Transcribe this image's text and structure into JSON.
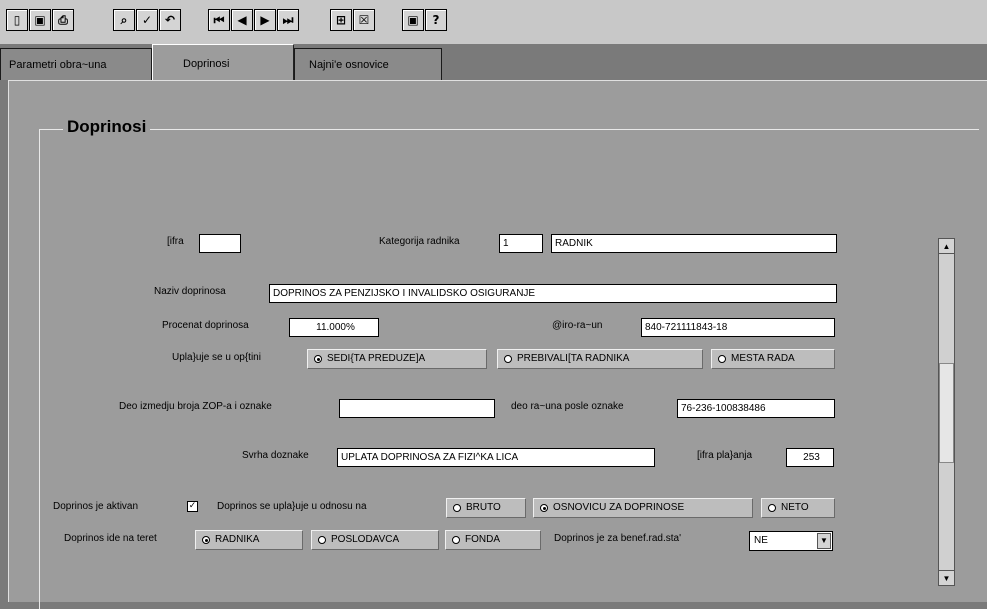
{
  "toolbar": {
    "groups": [
      [
        "exit-icon",
        "save-icon",
        "print-icon"
      ],
      [
        "search-icon",
        "confirm-icon",
        "undo-icon"
      ],
      [
        "first-record-icon",
        "previous-record-icon",
        "next-record-icon",
        "last-record-icon"
      ],
      [
        "add-record-icon",
        "delete-record-icon"
      ],
      [
        "info-icon",
        "help-icon"
      ]
    ],
    "glyphs": {
      "exit": "▯",
      "save": "▣",
      "print": "⎙",
      "search": "⌕",
      "confirm": "✓",
      "undo": "↶",
      "first": "⏮",
      "prev": "◀",
      "next": "▶",
      "last": "⏭",
      "add": "⊞",
      "delete": "☒",
      "info": "▣",
      "help": "?"
    }
  },
  "tabs": [
    {
      "label": "Parametri obra~una",
      "active": false
    },
    {
      "label": "Doprinosi",
      "active": true
    },
    {
      "label": "Najni'e osnovice",
      "active": false
    }
  ],
  "group_title": "Doprinosi",
  "form": {
    "sifra_label": "[ifra",
    "sifra_value": "",
    "kategorija_label": "Kategorija radnika",
    "kategorija_code": "1",
    "kategorija_name": "RADNIK",
    "naziv_label": "Naziv doprinosa",
    "naziv_value": "DOPRINOS ZA PENZIJSKO I INVALIDSKO OSIGURANJE",
    "procenat_label": "Procenat doprinosa",
    "procenat_value": "11.000%",
    "ziro_label": "@iro-ra~un",
    "ziro_value": "840-721111843-18",
    "uplata_label": "Upla}uje se u op{tini",
    "uplata_options": [
      "SEDI{TA PREDUZE]A",
      "PREBIVALI[TA RADNIKA",
      "MESTA RADA"
    ],
    "deo_label": "Deo izmedju broja ZOP-a i oznake",
    "deo_value": "",
    "deo_racuna_label": "deo ra~una posle oznake",
    "deo_racuna_value": "76-236-100838486",
    "svrha_label": "Svrha doznake",
    "svrha_value": "UPLATA DOPRINOSA ZA FIZI^KA LICA",
    "sifra_placanja_label": "[ifra pla}anja",
    "sifra_placanja_value": "253",
    "aktivan_label": "Doprinos je aktivan",
    "aktivan_checked": true,
    "aktivan_mark": "✓",
    "odnos_label": "Doprinos se upla}uje u odnosu na",
    "odnos_options": [
      "BRUTO",
      "OSNOVICU ZA DOPRINOSE",
      "NETO"
    ],
    "teret_label": "Doprinos ide na teret",
    "teret_options": [
      "RADNIKA",
      "POSLODAVCA",
      "FONDA"
    ],
    "benef_label": "Doprinos je za benef.rad.sta'",
    "benef_value": "NE",
    "benef_arrow": "▼"
  },
  "scrollbar": {
    "up": "▲",
    "down": "▼"
  }
}
